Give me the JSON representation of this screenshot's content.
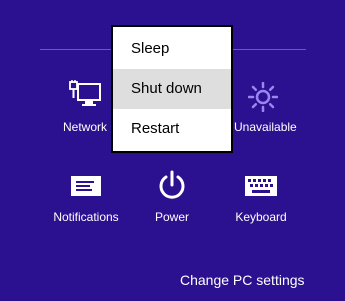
{
  "settings": {
    "tiles": {
      "network": {
        "label": "Network",
        "icon": "network-icon"
      },
      "unavailable": {
        "label": "Unavailable",
        "icon": "brightness-icon"
      },
      "notifications": {
        "label": "Notifications",
        "icon": "notifications-icon"
      },
      "power": {
        "label": "Power",
        "icon": "power-icon"
      },
      "keyboard": {
        "label": "Keyboard",
        "icon": "keyboard-icon"
      }
    },
    "change_pc_settings": "Change PC settings"
  },
  "power_menu": {
    "items": [
      {
        "label": "Sleep",
        "selected": false
      },
      {
        "label": "Shut down",
        "selected": true
      },
      {
        "label": "Restart",
        "selected": false
      }
    ]
  },
  "colors": {
    "background": "#2b1190",
    "menu_background": "#ffffff",
    "menu_highlight": "#dedede",
    "menu_border": "#000000",
    "divider": "#6b58b8"
  }
}
